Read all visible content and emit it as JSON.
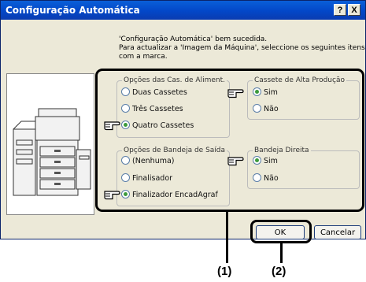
{
  "window": {
    "title": "Configuração Automática",
    "help_label": "?",
    "close_label": "X"
  },
  "message": {
    "line1": "'Configuração Automática' bem sucedida.",
    "line2": "Para actualizar a 'Imagem da Máquina', seleccione os seguintes itens",
    "line3": "com a marca."
  },
  "groups": {
    "paper_feed": {
      "legend": "Opções das Cas. de Aliment.",
      "options": [
        "Duas Cassetes",
        "Três Cassetes",
        "Quatro Cassetes"
      ],
      "selected": "Quatro Cassetes"
    },
    "large_cassette": {
      "legend": "Cassete de Alta Produção",
      "options": [
        "Sim",
        "Não"
      ],
      "selected": "Sim"
    },
    "output_tray": {
      "legend": "Opções de Bandeja de Saída",
      "options": [
        "(Nenhuma)",
        "Finalisador",
        "Finalizador EncadAgraf"
      ],
      "selected": "Finalizador EncadAgraf"
    },
    "right_tray": {
      "legend": "Bandeja Direita",
      "options": [
        "Sim",
        "Não"
      ],
      "selected": "Sim"
    }
  },
  "buttons": {
    "ok": "OK",
    "cancel": "Cancelar"
  },
  "callouts": {
    "one": "(1)",
    "two": "(2)"
  }
}
